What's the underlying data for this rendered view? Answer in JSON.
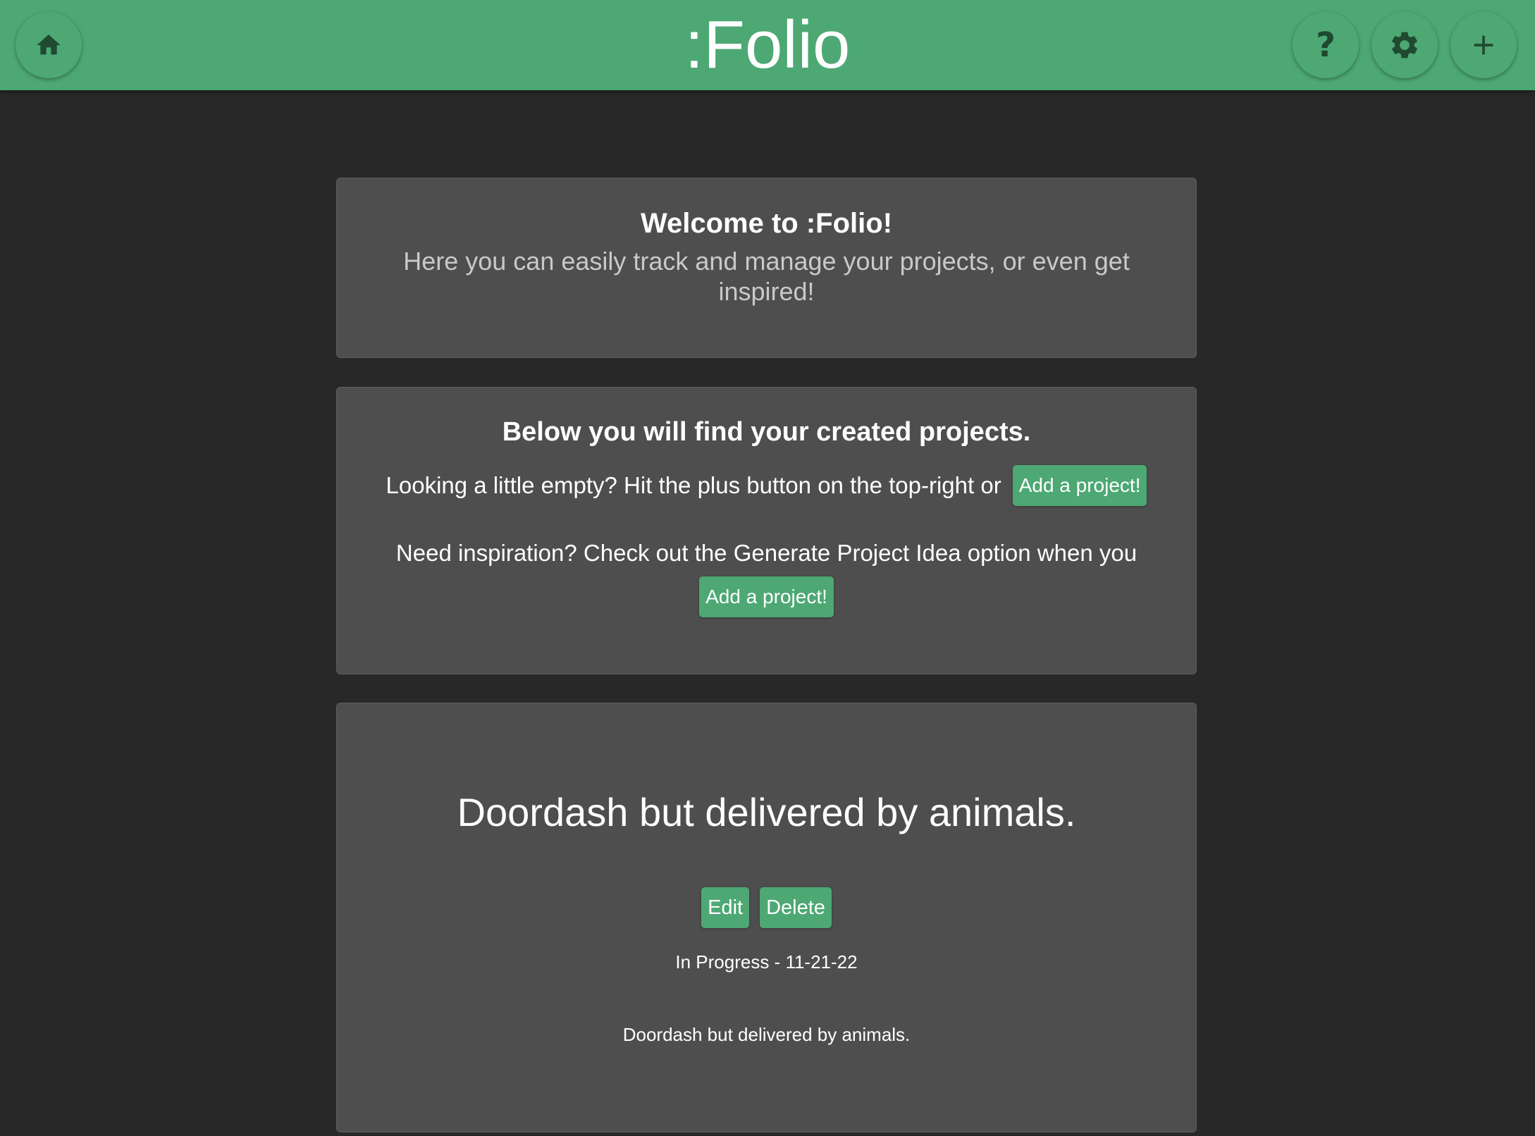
{
  "header": {
    "title": ":Folio",
    "home_icon": "home-icon",
    "help_icon": "help-icon",
    "help_label": "?",
    "settings_icon": "gear-icon",
    "add_icon": "plus-icon",
    "color": "#4da874"
  },
  "welcome": {
    "title": "Welcome to :Folio!",
    "subtitle": "Here you can easily track and manage your projects, or even get inspired!"
  },
  "projects_intro": {
    "title": "Below you will find your created projects.",
    "empty_text": "Looking a little empty? Hit the plus button on the top-right or",
    "add_button": "Add a project!",
    "inspiration_text": "Need inspiration? Check out the Generate Project Idea option when you",
    "add_button_2": "Add a project!"
  },
  "project": {
    "title": "Doordash but delivered by animals.",
    "edit_label": "Edit",
    "delete_label": "Delete",
    "status": "In Progress - 11-21-22",
    "description": "Doordash but delivered by animals."
  }
}
